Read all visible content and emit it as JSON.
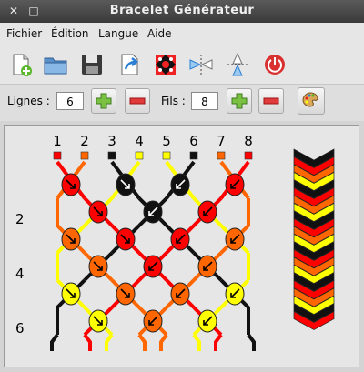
{
  "window": {
    "title": "Bracelet Générateur"
  },
  "menu": {
    "items": [
      "Fichier",
      "Édition",
      "Langue",
      "Aide"
    ]
  },
  "toolbar": {
    "tools": [
      "new-file-icon",
      "open-folder-icon",
      "save-floppy-icon",
      "export-icon",
      "pattern-icon",
      "flip-horizontal-icon",
      "flip-vertical-icon",
      "quit-power-icon"
    ]
  },
  "params": {
    "rows_label": "Lignes :",
    "rows_value": "6",
    "threads_label": "Fils :",
    "threads_value": "8"
  },
  "pattern": {
    "thread_numbers": [
      "1",
      "2",
      "3",
      "4",
      "5",
      "6",
      "7",
      "8"
    ],
    "row_numbers": [
      "2",
      "4",
      "6"
    ],
    "thread_colors": [
      "#ff0000",
      "#ff6600",
      "#111111",
      "#ffff00",
      "#ffff00",
      "#111111",
      "#ff6600",
      "#ff0000"
    ],
    "palette": {
      "red": "#ff0000",
      "orange": "#ff6600",
      "black": "#111111",
      "yellow": "#ffff00"
    }
  }
}
